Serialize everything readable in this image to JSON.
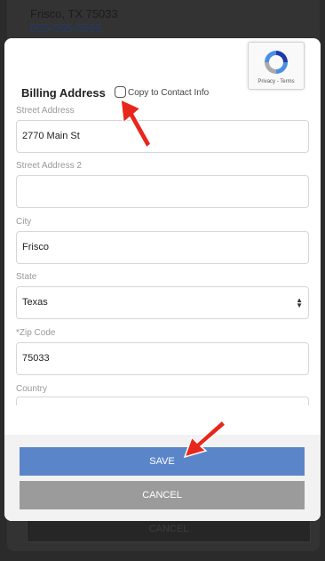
{
  "background": {
    "address_line": "Frisco, TX 75033",
    "phone": "555-555-5555",
    "cancel_label": "CANCEL"
  },
  "recaptcha": {
    "links": "Privacy - Terms"
  },
  "billing": {
    "title": "Billing Address",
    "copy_label": "Copy to Contact Info",
    "copy_checked": false
  },
  "fields": {
    "street_address": {
      "label": "Street Address",
      "value": "2770 Main St"
    },
    "street_address_2": {
      "label": "Street Address 2",
      "value": ""
    },
    "city": {
      "label": "City",
      "value": "Frisco"
    },
    "state": {
      "label": "State",
      "value": "Texas"
    },
    "zip": {
      "label": "*Zip Code",
      "value": "75033"
    },
    "country": {
      "label": "Country",
      "value": ""
    }
  },
  "actions": {
    "save_label": "SAVE",
    "cancel_label": "CANCEL"
  },
  "colors": {
    "save": "#5a85c9",
    "cancel": "#9b9b9b",
    "arrow": "#e8271b"
  }
}
